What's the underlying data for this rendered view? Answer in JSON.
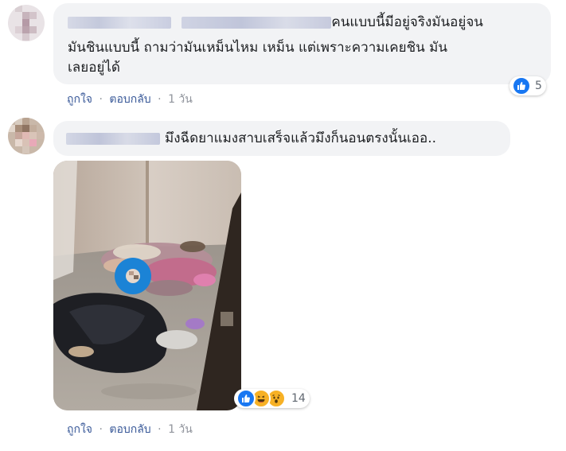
{
  "comments": [
    {
      "text": "คนแบบนี้มีอยู่จริงมันอยู่จน มันชินแบบนี้ ถามว่ามันเหม็นไหม เหม็น แต่เพราะความเคยชิน มัน เลยอยู่ได้",
      "text_line1": "คนแบบนี้มีอยู่จริงมันอยู่จน",
      "text_line2": "มันชินแบบนี้ ถามว่ามันเหม็นไหม เหม็น แต่เพราะความเคยชิน มัน",
      "text_line3": "เลยอยู่ได้",
      "like_label": "ถูกใจ",
      "reply_label": "ตอบกลับ",
      "time": "1 วัน",
      "separator": "·",
      "reaction_count": "5",
      "reaction_icons": [
        "like-icon"
      ]
    },
    {
      "text": "มึงฉีดยาแมงสาบเสร็จแล้วมึงก็นอนตรงนั้นเออ..",
      "like_label": "ถูกใจ",
      "reply_label": "ตอบกลับ",
      "time": "1 วัน",
      "separator": "·",
      "reaction_count": "14",
      "reaction_icons": [
        "like-icon",
        "haha-icon",
        "wow-icon"
      ]
    }
  ],
  "colors": {
    "link": "#385898",
    "bubble": "#f2f3f5",
    "like_blue": "#1877f2",
    "emoji_yellow": "#f7b125"
  }
}
